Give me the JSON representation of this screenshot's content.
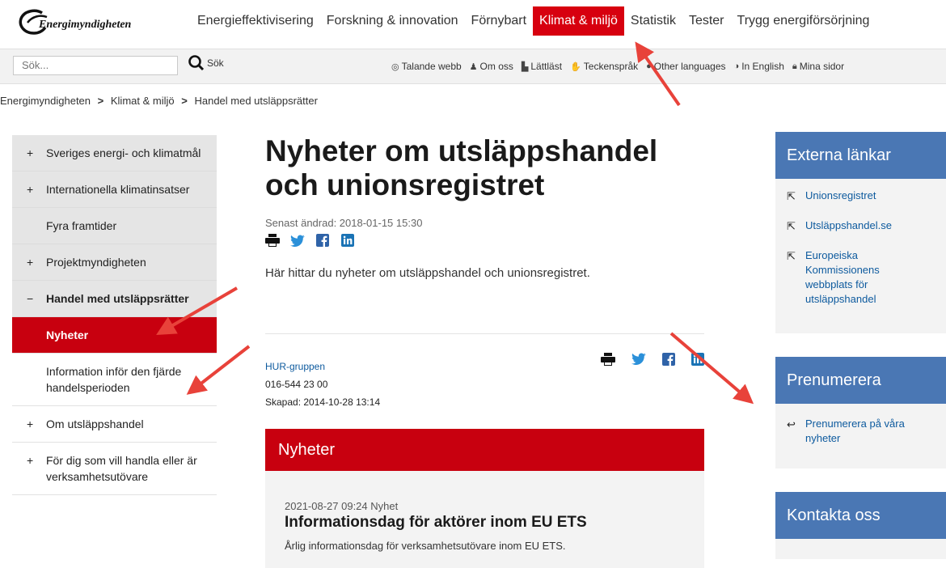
{
  "header": {
    "logo_text": "Energimyndigheten",
    "nav": [
      {
        "label": "Energieffektivisering"
      },
      {
        "label": "Forskning & innovation"
      },
      {
        "label": "Förnybart"
      },
      {
        "label": "Klimat & miljö"
      },
      {
        "label": "Statistik"
      },
      {
        "label": "Tester"
      },
      {
        "label": "Trygg energiförsörjning"
      }
    ],
    "active_nav": "Klimat & miljö"
  },
  "utility": {
    "search_placeholder": "Sök...",
    "search_button": "Sök",
    "links": [
      {
        "label": "Talande webb",
        "icon": "speaker-icon"
      },
      {
        "label": "Om oss",
        "icon": "person-icon"
      },
      {
        "label": "Lättläst",
        "icon": "easy-read-icon"
      },
      {
        "label": "Teckenspråk",
        "icon": "sign-language-icon"
      },
      {
        "label": "Other languages",
        "icon": "speech-bubble-icon"
      },
      {
        "label": "In English",
        "icon": "globe-icon"
      },
      {
        "label": "Mina sidor",
        "icon": "lock-icon"
      }
    ]
  },
  "breadcrumb": {
    "items": [
      "Energimyndigheten",
      "Klimat & miljö",
      "Handel med utsläppsrätter"
    ],
    "separator": ">"
  },
  "sidebar": {
    "items": [
      {
        "sign": "+",
        "label": "Sveriges energi- och klimatmål"
      },
      {
        "sign": "+",
        "label": "Internationella klimatinsatser"
      },
      {
        "sign": "",
        "label": "Fyra framtider"
      },
      {
        "sign": "+",
        "label": "Projektmyndigheten"
      },
      {
        "sign": "−",
        "label": "Handel med utsläppsrätter"
      }
    ],
    "subitems": [
      {
        "label": "Nyheter"
      },
      {
        "label": "Information inför den fjärde handelsperioden"
      }
    ],
    "after": [
      {
        "sign": "+",
        "label": "Om utsläppshandel"
      },
      {
        "sign": "+",
        "label": "För dig som vill handla eller är verksamhetsutövare"
      }
    ]
  },
  "main": {
    "title": "Nyheter om utsläppshandel och unionsregistret",
    "updated": "Senast ändrad: 2018-01-15 15:30",
    "intro": "Här hittar du nyheter om utsläppshandel och unionsregistret.",
    "contact": {
      "group": "HUR-gruppen",
      "phone": "016-544 23 00",
      "created": "Skapad: 2014-10-28 13:14"
    },
    "news_header": "Nyheter",
    "news": {
      "meta": "2021-08-27 09:24 Nyhet",
      "title": "Informationsdag för aktörer inom EU ETS",
      "excerpt": "Årlig informationsdag för verksamhetsutövare inom EU ETS."
    }
  },
  "right": {
    "external": {
      "title": "Externa länkar",
      "links": [
        {
          "label": "Unionsregistret"
        },
        {
          "label": "Utsläppshandel.se"
        },
        {
          "label": "Europeiska Kommissionens webbplats för utsläppshandel"
        }
      ]
    },
    "subscribe": {
      "title": "Prenumerera",
      "links": [
        {
          "label": "Prenumerera på våra nyheter"
        }
      ]
    },
    "contact": {
      "title": "Kontakta oss"
    }
  },
  "colors": {
    "brand_red": "#c8000f",
    "nav_active_red": "#d7000f",
    "box_blue": "#4a77b4",
    "link_blue": "#0d5a9e",
    "annotation_arrow": "#e8423a"
  }
}
